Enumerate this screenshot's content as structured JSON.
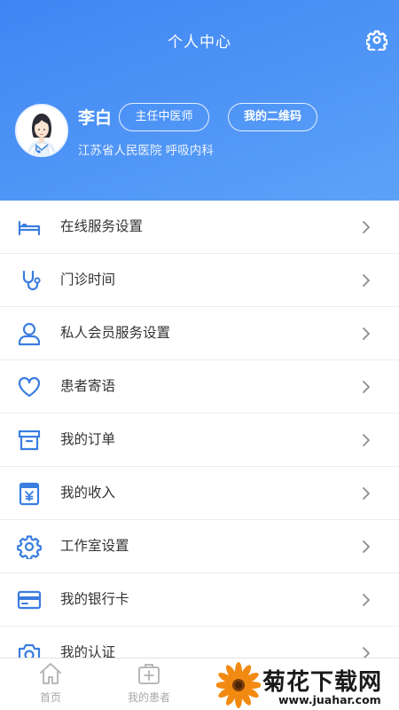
{
  "header": {
    "title": "个人中心",
    "settings_icon": "gear-icon"
  },
  "profile": {
    "name": "李白",
    "title_badge": "主任中医师",
    "qr_button": "我的二维码",
    "hospital": "江苏省人民医院 呼吸内科",
    "avatar_icon": "doctor-avatar-icon"
  },
  "menu": {
    "items": [
      {
        "label": "在线服务设置",
        "icon": "bed-icon"
      },
      {
        "label": "门诊时间",
        "icon": "stethoscope-icon"
      },
      {
        "label": "私人会员服务设置",
        "icon": "user-icon"
      },
      {
        "label": "患者寄语",
        "icon": "heart-icon"
      },
      {
        "label": "我的订单",
        "icon": "archive-box-icon"
      },
      {
        "label": "我的收入",
        "icon": "yuan-calendar-icon"
      },
      {
        "label": "工作室设置",
        "icon": "cog-icon"
      },
      {
        "label": "我的银行卡",
        "icon": "credit-card-icon"
      },
      {
        "label": "我的认证",
        "icon": "camera-icon"
      }
    ]
  },
  "tabbar": {
    "tabs": [
      {
        "label": "首页",
        "icon": "home-icon"
      },
      {
        "label": "我的患者",
        "icon": "medical-kit-icon"
      }
    ]
  },
  "watermark": {
    "text": "菊花下载网",
    "url": "www.juahar.com"
  },
  "colors": {
    "primary": "#3f86f3",
    "icon_blue": "#3a7de0",
    "tab_gray": "#a7a7a7"
  }
}
